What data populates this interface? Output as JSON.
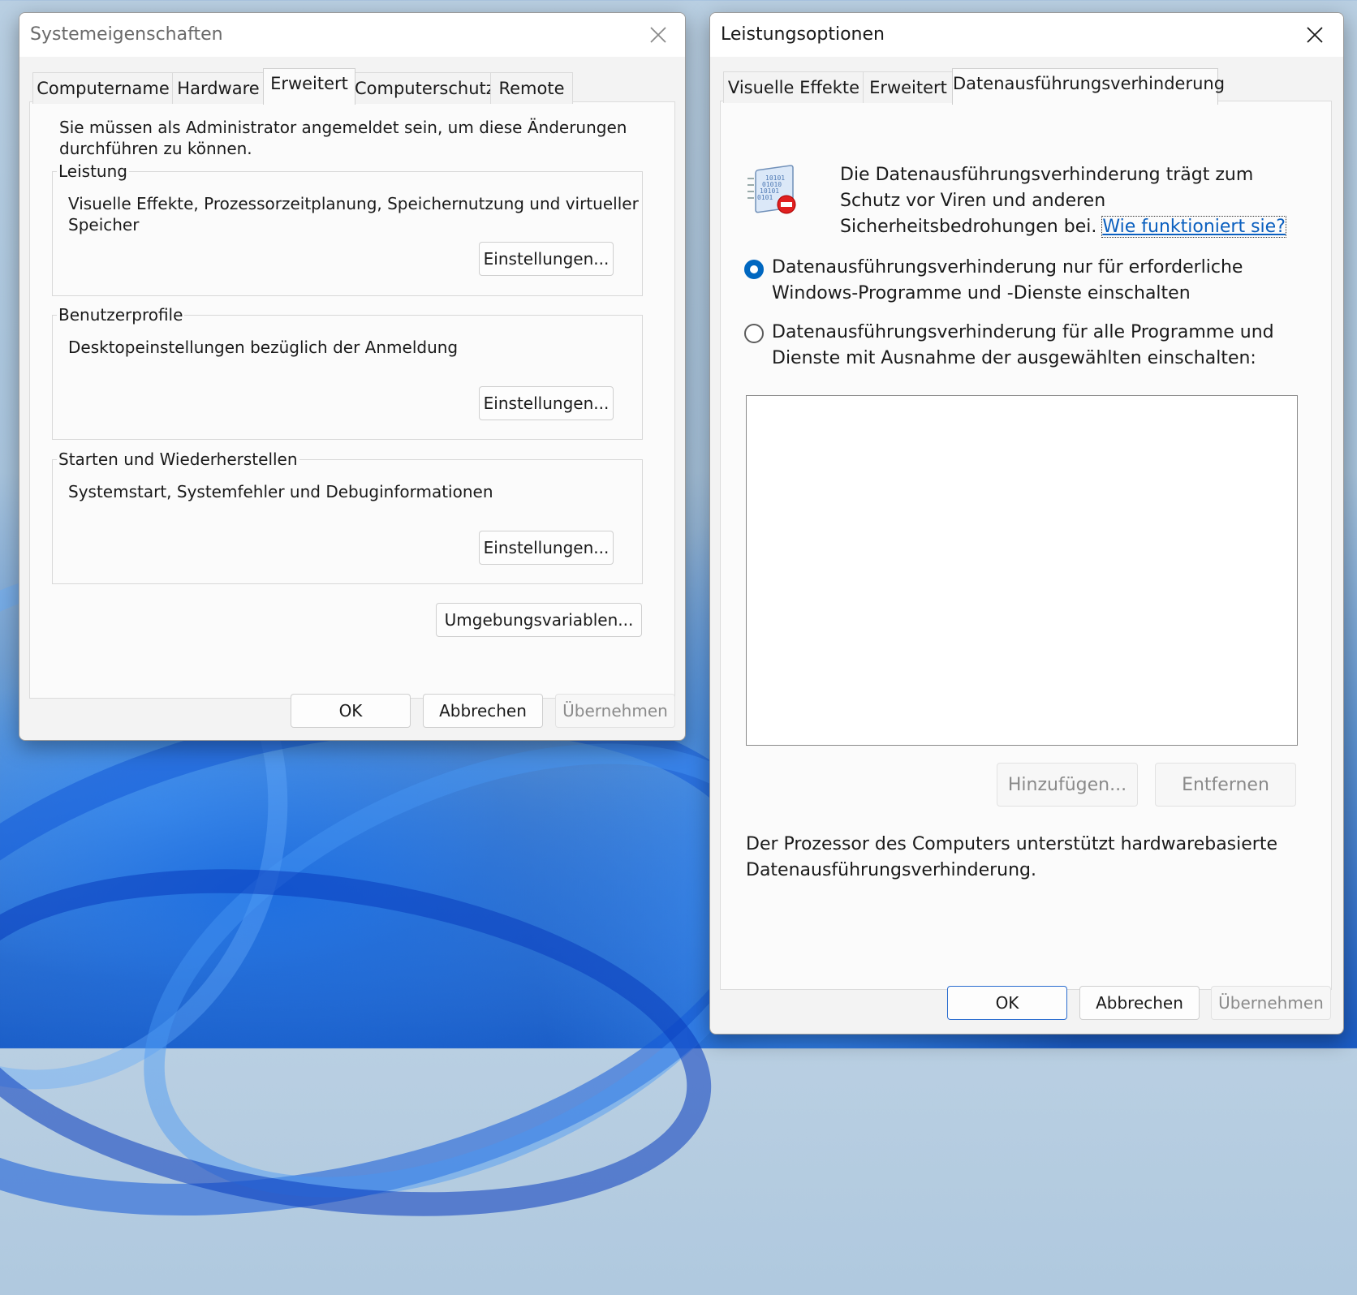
{
  "left_window": {
    "title": "Systemeigenschaften",
    "tabs": [
      "Computername",
      "Hardware",
      "Erweitert",
      "Computerschutz",
      "Remote"
    ],
    "selected_tab": "Erweitert",
    "admin_notice_line1": "Sie müssen als Administrator angemeldet sein, um diese Änderungen",
    "admin_notice_line2": "durchführen zu können.",
    "groups": [
      {
        "legend": "Leistung",
        "desc_line1": "Visuelle Effekte, Prozessorzeitplanung, Speichernutzung und virtueller",
        "desc_line2": "Speicher",
        "button": "Einstellungen..."
      },
      {
        "legend": "Benutzerprofile",
        "desc_line1": "Desktopeinstellungen bezüglich der Anmeldung",
        "desc_line2": "",
        "button": "Einstellungen..."
      },
      {
        "legend": "Starten und Wiederherstellen",
        "desc_line1": "Systemstart, Systemfehler und Debuginformationen",
        "desc_line2": "",
        "button": "Einstellungen..."
      }
    ],
    "env_button": "Umgebungsvariablen...",
    "ok": "OK",
    "cancel": "Abbrechen",
    "apply": "Übernehmen"
  },
  "right_window": {
    "title": "Leistungsoptionen",
    "tabs": [
      "Visuelle Effekte",
      "Erweitert",
      "Datenausführungsverhinderung"
    ],
    "selected_tab": "Datenausführungsverhinderung",
    "icon": "dep-shield-icon",
    "intro_line1": "Die Datenausführungsverhinderung trägt zum",
    "intro_line2": "Schutz vor Viren und anderen",
    "intro_line3": "Sicherheitsbedrohungen bei.",
    "help_link": "Wie funktioniert sie?",
    "option1_line1": "Datenausführungsverhinderung nur für erforderliche",
    "option1_line2": "Windows-Programme und -Dienste einschalten",
    "option1_checked": true,
    "option2_line1": "Datenausführungsverhinderung für alle Programme und",
    "option2_line2": "Dienste mit Ausnahme der ausgewählten einschalten:",
    "option2_checked": false,
    "add_button": "Hinzufügen...",
    "remove_button": "Entfernen",
    "status_line1": "Der Prozessor des Computers unterstützt hardwarebasierte",
    "status_line2": "Datenausführungsverhinderung.",
    "ok": "OK",
    "cancel": "Abbrechen",
    "apply": "Übernehmen"
  },
  "colors": {
    "accent": "#0067c0",
    "link": "#0a5fbf"
  }
}
